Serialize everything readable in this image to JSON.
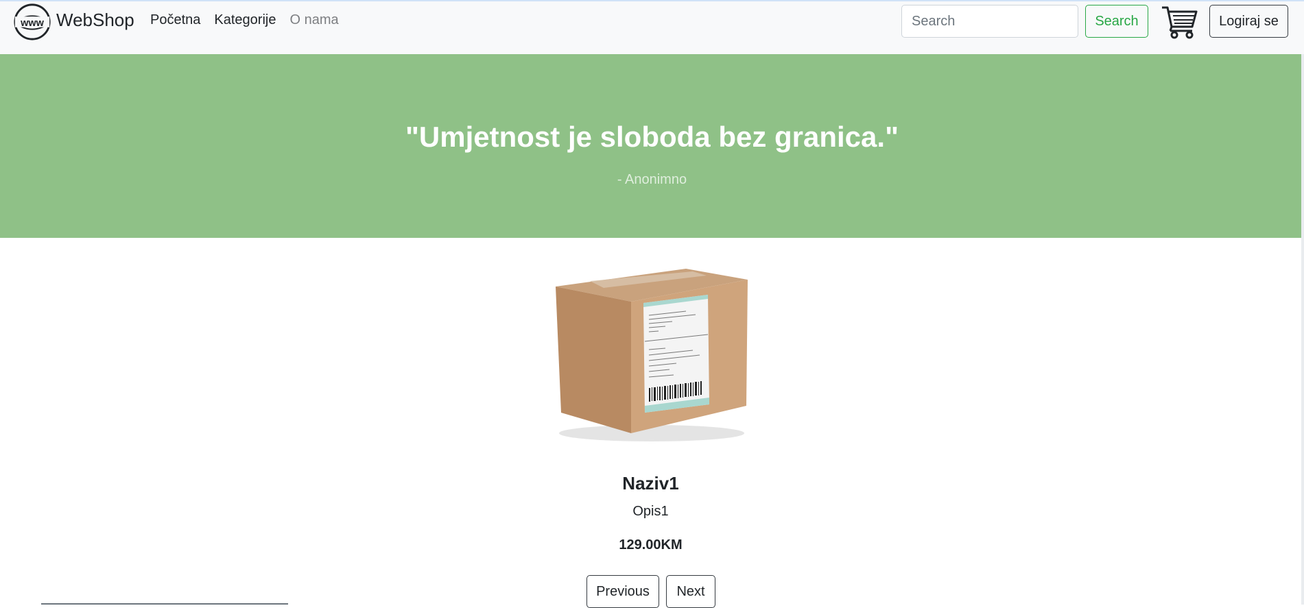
{
  "navbar": {
    "brand_logo_text": "www",
    "brand": "WebShop",
    "links": [
      "Početna",
      "Kategorije",
      "O nama"
    ],
    "search_placeholder": "Search",
    "search_button": "Search",
    "cart_icon": "shopping-cart-icon",
    "login_button": "Logiraj se"
  },
  "hero": {
    "quote": "\"Umjetnost je sloboda bez granica.\"",
    "author": "- Anonimno",
    "background_color": "#8fc187"
  },
  "product": {
    "image_icon": "cardboard-box-image",
    "name": "Naziv1",
    "description": "Opis1",
    "price": "129.00KM"
  },
  "pagination": {
    "previous": "Previous",
    "next": "Next"
  },
  "colors": {
    "success": "#28a745",
    "dark": "#343a40"
  }
}
